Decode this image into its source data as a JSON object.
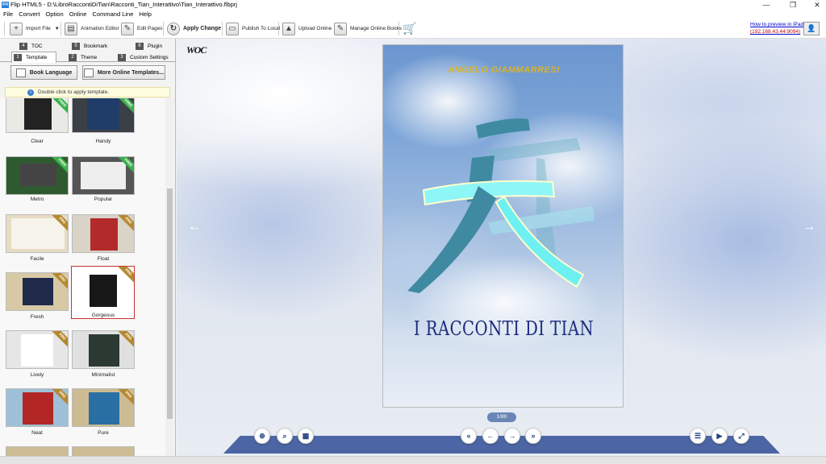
{
  "window": {
    "title": "Flip HTML5 - D:\\LibroRaccontiDiTian\\Racconti_Tian_Interattivo\\Tian_Interattivo.flbprj",
    "icon_text": "FH",
    "minimize": "—",
    "maximize": "❐",
    "close": "✕"
  },
  "menu": [
    "File",
    "Convert",
    "Option",
    "Online",
    "Command Line",
    "Help"
  ],
  "toolbar": {
    "import_file": "Import File",
    "animation_editor": "Animation Editor",
    "edit_pages": "Edit Pages",
    "apply_change": "Apply Change",
    "publish_local": "Publish To Local",
    "upload_online": "Upload Online",
    "manage_online": "Manage Online Books",
    "preview_link": "How to preview in iPad",
    "preview_ip": "(192.168.43.44:9094)"
  },
  "tabs": [
    {
      "num": "4",
      "label": "TOC"
    },
    {
      "num": "5",
      "label": "Bookmark"
    },
    {
      "num": "6",
      "label": "Plugin"
    },
    {
      "num": "1",
      "label": "Template"
    },
    {
      "num": "2",
      "label": "Theme"
    },
    {
      "num": "3",
      "label": "Custom Settings"
    }
  ],
  "buttons": {
    "book_language": "Book Language",
    "more_templates": "More Online Templates..."
  },
  "hint": "Double click to apply template.",
  "templates": [
    {
      "name": "Clear",
      "badge": "FREE"
    },
    {
      "name": "Handy",
      "badge": "FREE"
    },
    {
      "name": "Metro",
      "badge": "FREE"
    },
    {
      "name": "Popular",
      "badge": "FREE"
    },
    {
      "name": "Facile",
      "badge": "PRO"
    },
    {
      "name": "Float",
      "badge": "PRO"
    },
    {
      "name": "Fresh",
      "badge": "PRO"
    },
    {
      "name": "Gorgeous",
      "badge": "PRO"
    },
    {
      "name": "Lively",
      "badge": "PRO"
    },
    {
      "name": "Minimalist",
      "badge": "PRO"
    },
    {
      "name": "Neat",
      "badge": "PRO"
    },
    {
      "name": "Pure",
      "badge": "PRO"
    }
  ],
  "preview": {
    "logo": "WOC",
    "author": "ANGELO GIAMMARRESI",
    "book_title": "I RACCONTI DI TIAN",
    "page_indicator": "1/80",
    "prev_arrow": "←",
    "next_arrow": "→"
  },
  "colors": {
    "accent": "#4c65a4",
    "title_blue": "#1d2c7c",
    "author_gold": "#d9b42a",
    "selected_border": "#cc3333"
  }
}
